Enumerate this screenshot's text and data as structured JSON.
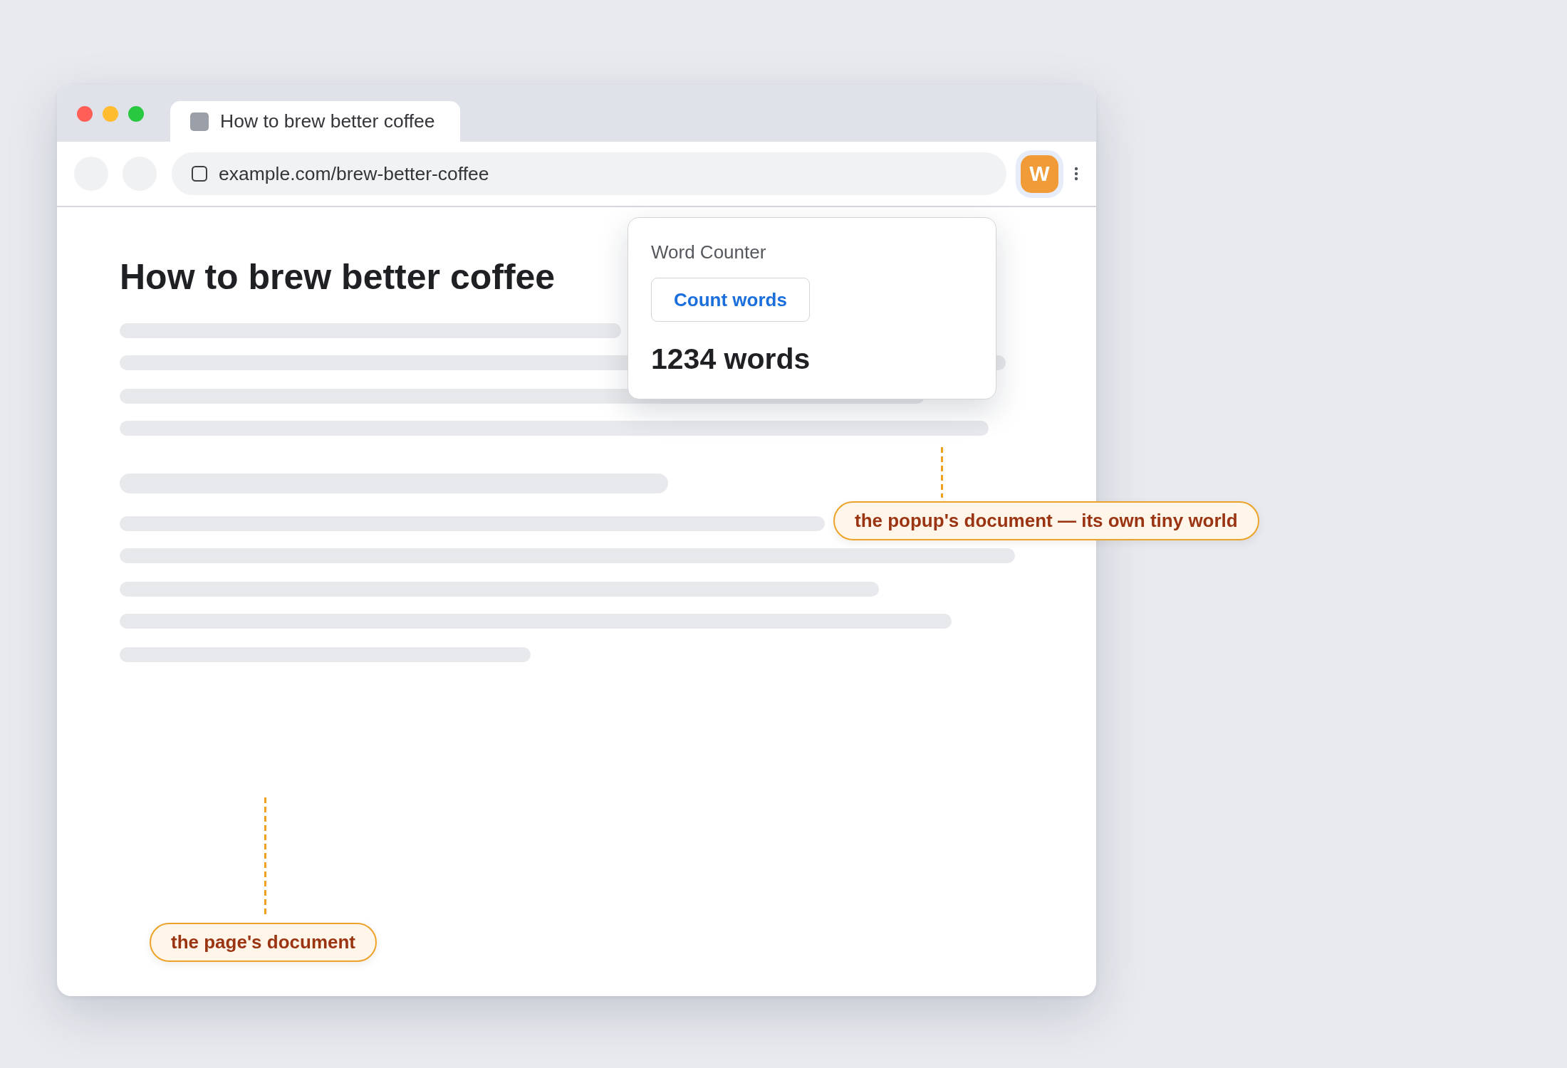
{
  "window": {
    "tabs": [
      {
        "title": "How to brew better coffee",
        "selected": true
      }
    ],
    "toolbar": {
      "address": "example.com/brew-better-coffee",
      "extension": {
        "label": "W",
        "active": true
      }
    }
  },
  "page": {
    "heading": "How to brew better coffee",
    "callout": "the page's document"
  },
  "popup": {
    "title": "Word Counter",
    "button": "Count words",
    "result": "1234 words",
    "callout": "the popup's document — its own tiny world"
  }
}
